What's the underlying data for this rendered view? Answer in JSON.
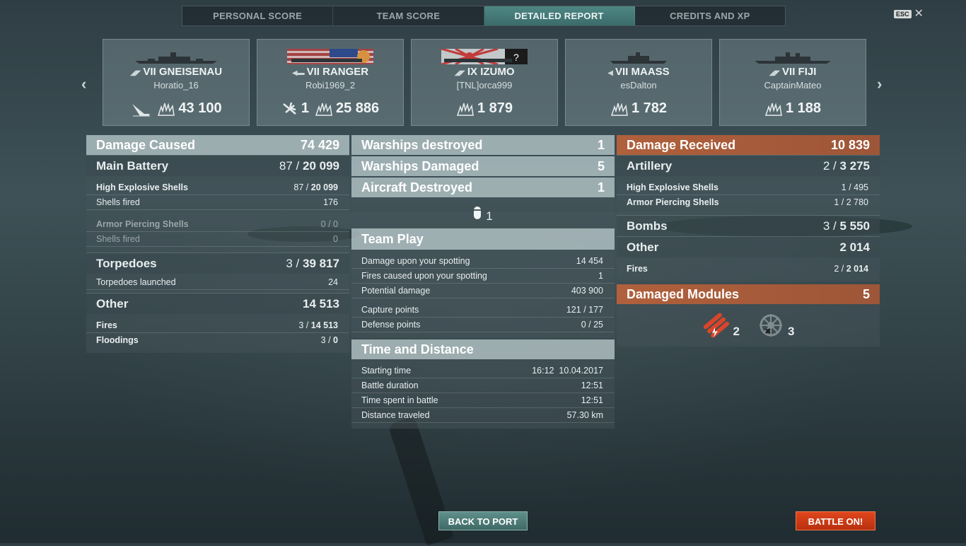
{
  "tabs": [
    {
      "label": "PERSONAL SCORE"
    },
    {
      "label": "TEAM SCORE"
    },
    {
      "label": "DETAILED REPORT"
    },
    {
      "label": "CREDITS AND XP"
    }
  ],
  "esc": {
    "key": "ESC"
  },
  "ships": [
    {
      "tier": "VII",
      "name": "GNEISENAU",
      "player": "Horatio_16",
      "extra": "",
      "damage": "43 100"
    },
    {
      "tier": "VII",
      "name": "RANGER",
      "player": "Robi1969_2",
      "extra": "1",
      "damage": "25 886"
    },
    {
      "tier": "IX",
      "name": "IZUMO",
      "player": "[TNL]orca999",
      "extra": "",
      "damage": "1 879"
    },
    {
      "tier": "VII",
      "name": "MAASS",
      "player": "esDalton",
      "extra": "",
      "damage": "1 782"
    },
    {
      "tier": "VII",
      "name": "FIJI",
      "player": "CaptainMateo",
      "extra": "",
      "damage": "1 188"
    }
  ],
  "left": {
    "header": {
      "label": "Damage Caused",
      "value": "74 429"
    },
    "main_battery": {
      "label": "Main Battery",
      "hits": "87 /",
      "value": "20 099"
    },
    "he": {
      "label": "High Explosive Shells",
      "hits": "87 /",
      "value": "20 099"
    },
    "he_fired": {
      "label": "Shells fired",
      "value": "176"
    },
    "ap": {
      "label": "Armor Piercing Shells",
      "value": "0 / 0"
    },
    "ap_fired": {
      "label": "Shells fired",
      "value": "0"
    },
    "torpedoes": {
      "label": "Torpedoes",
      "hits": "3 /",
      "value": "39 817"
    },
    "torp_launched": {
      "label": "Torpedoes launched",
      "value": "24"
    },
    "other": {
      "label": "Other",
      "value": "14 513"
    },
    "fires": {
      "label": "Fires",
      "hits": "3 /",
      "value": "14 513"
    },
    "floodings": {
      "label": "Floodings",
      "hits": "3 /",
      "value": "0"
    }
  },
  "middle": {
    "warships_destroyed": {
      "label": "Warships destroyed",
      "value": "1"
    },
    "warships_damaged": {
      "label": "Warships Damaged",
      "value": "5"
    },
    "aircraft_destroyed": {
      "label": "Aircraft Destroyed",
      "value": "1"
    },
    "aircraft_icon_count": "1",
    "team_play": {
      "label": "Team Play",
      "rows": [
        {
          "label": "Damage upon your spotting",
          "value": "14 454"
        },
        {
          "label": "Fires caused upon your spotting",
          "value": "1"
        },
        {
          "label": "Potential damage",
          "value": "403 900"
        },
        {
          "label": "Capture points",
          "value": "121 / 177"
        },
        {
          "label": "Defense points",
          "value": "0 / 25"
        }
      ]
    },
    "time_distance": {
      "label": "Time and Distance",
      "rows": [
        {
          "label": "Starting time",
          "value": "16:12  10.04.2017"
        },
        {
          "label": "Battle duration",
          "value": "12:51"
        },
        {
          "label": "Time spent in battle",
          "value": "12:51"
        },
        {
          "label": "Distance traveled",
          "value": "57.30 km"
        }
      ]
    }
  },
  "right": {
    "header": {
      "label": "Damage Received",
      "value": "10 839"
    },
    "artillery": {
      "label": "Artillery",
      "hits": "2 /",
      "value": "3 275"
    },
    "he": {
      "label": "High Explosive Shells",
      "value": "1 / 495"
    },
    "ap": {
      "label": "Armor Piercing Shells",
      "value": "1 / 2 780"
    },
    "bombs": {
      "label": "Bombs",
      "hits": "3 /",
      "value": "5 550"
    },
    "other": {
      "label": "Other",
      "value": "2 014"
    },
    "fires": {
      "label": "Fires",
      "hits": "2 /",
      "value": "2 014"
    },
    "modules": {
      "label": "Damaged Modules",
      "value": "5",
      "torpedo_count": "2",
      "steering_count": "3"
    }
  },
  "buttons": {
    "back": "BACK TO PORT",
    "battle": "BATTLE ON!"
  },
  "colors": {
    "accent_tab": "#3f6f6e",
    "received": "#a65a3a",
    "battle_button": "#d23d15"
  }
}
